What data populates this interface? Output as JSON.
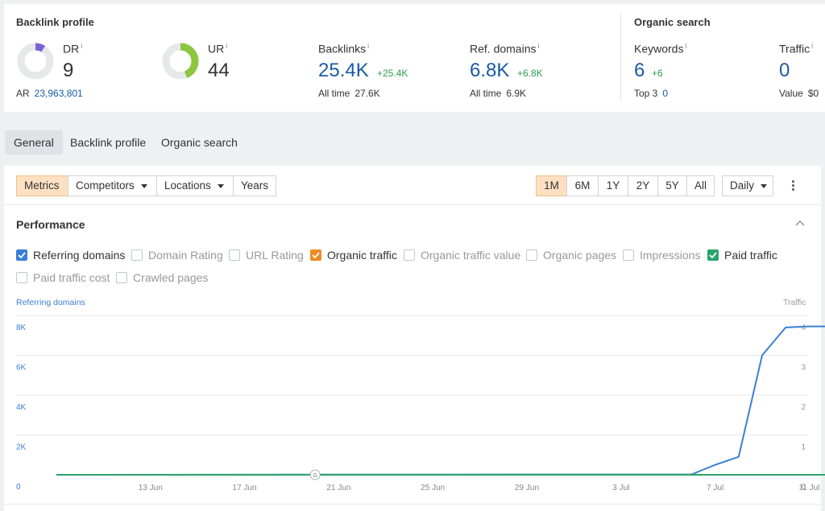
{
  "backlink_profile": {
    "title": "Backlink profile",
    "dr": {
      "label": "DR",
      "value": "9",
      "fraction": 0.09
    },
    "ur": {
      "label": "UR",
      "value": "44",
      "fraction": 0.44
    },
    "ar": {
      "label": "AR",
      "value": "23,963,801"
    },
    "backlinks": {
      "label": "Backlinks",
      "value": "25.4K",
      "delta": "+25.4K",
      "sub_label": "All time",
      "sub_value": "27.6K"
    },
    "ref_domains": {
      "label": "Ref. domains",
      "value": "6.8K",
      "delta": "+6.8K",
      "sub_label": "All time",
      "sub_value": "6.9K"
    },
    "info_glyph": "i"
  },
  "organic_search": {
    "title": "Organic search",
    "keywords": {
      "label": "Keywords",
      "value": "6",
      "delta": "+6",
      "sub_label": "Top 3",
      "sub_value": "0"
    },
    "traffic": {
      "label": "Traffic",
      "value": "0",
      "sub_label": "Value",
      "sub_value": "$0"
    }
  },
  "tabs": [
    {
      "label": "General",
      "active": true
    },
    {
      "label": "Backlink profile",
      "active": false
    },
    {
      "label": "Organic search",
      "active": false
    }
  ],
  "toolbar": {
    "left": [
      {
        "label": "Metrics",
        "active": true,
        "dropdown": false
      },
      {
        "label": "Competitors",
        "active": false,
        "dropdown": true
      },
      {
        "label": "Locations",
        "active": false,
        "dropdown": true
      },
      {
        "label": "Years",
        "active": false,
        "dropdown": false
      }
    ],
    "ranges": [
      {
        "label": "1M",
        "active": true
      },
      {
        "label": "6M",
        "active": false
      },
      {
        "label": "1Y",
        "active": false
      },
      {
        "label": "2Y",
        "active": false
      },
      {
        "label": "5Y",
        "active": false
      },
      {
        "label": "All",
        "active": false
      }
    ],
    "granularity": "Daily"
  },
  "performance": {
    "title": "Performance",
    "checkboxes": [
      {
        "label": "Referring domains",
        "checked": true,
        "color": "#3b7fd4"
      },
      {
        "label": "Domain Rating",
        "checked": false
      },
      {
        "label": "URL Rating",
        "checked": false
      },
      {
        "label": "Organic traffic",
        "checked": true,
        "color": "#f08a24"
      },
      {
        "label": "Organic traffic value",
        "checked": false
      },
      {
        "label": "Organic pages",
        "checked": false
      },
      {
        "label": "Impressions",
        "checked": false
      },
      {
        "label": "Paid traffic",
        "checked": true,
        "color": "#2aa36b"
      },
      {
        "label": "Paid traffic cost",
        "checked": false
      },
      {
        "label": "Crawled pages",
        "checked": false
      }
    ]
  },
  "chart_data": {
    "type": "line",
    "ylabel": "Referring domains",
    "y2label": "Traffic",
    "ylim": [
      0,
      8000
    ],
    "y2lim": [
      0,
      4
    ],
    "yticks": [
      "8K",
      "6K",
      "4K",
      "2K",
      "0"
    ],
    "y2ticks": [
      "4",
      "3",
      "2",
      "1",
      "0"
    ],
    "x_tick_labels": [
      "13 Jun",
      "17 Jun",
      "21 Jun",
      "25 Jun",
      "29 Jun",
      "3 Jul",
      "7 Jul",
      "11 Jul"
    ],
    "x_tick_days": [
      4,
      8,
      12,
      16,
      20,
      24,
      28,
      32
    ],
    "annotation": {
      "label": "G",
      "day": 11
    },
    "grid": true,
    "series": [
      {
        "name": "Referring domains",
        "color": "#3b7fd4",
        "axis": "left",
        "days": [
          0,
          27,
          28,
          29,
          30,
          31,
          32,
          33
        ],
        "values": [
          0,
          20,
          500,
          900,
          6000,
          7400,
          7450,
          7450
        ]
      },
      {
        "name": "Paid traffic",
        "color": "#2aa36b",
        "axis": "right",
        "days": [
          0,
          33
        ],
        "values": [
          0,
          0
        ]
      }
    ]
  },
  "colors": {
    "accent_orange": "#fde0c2",
    "link_blue": "#1a5aa8",
    "delta_green": "#2a9d4f",
    "dr_purple": "#7b61d9",
    "ur_green": "#8dc63f"
  }
}
